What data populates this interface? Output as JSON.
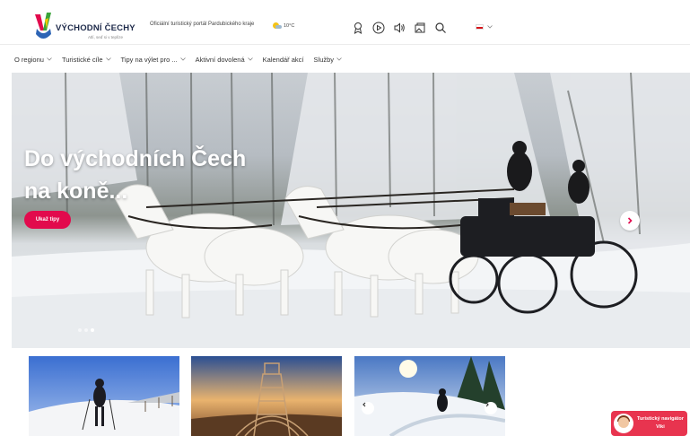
{
  "header": {
    "logo_text": "VÝCHODNÍ ČECHY",
    "logo_tagline": "Atlí, seď si v teplíze",
    "portal_text": "Oficiální turistický portál Pardubického kraje",
    "weather_temp": "10°C",
    "icons": [
      "award-icon",
      "play-icon",
      "speaker-icon",
      "gallery-icon",
      "search-icon"
    ],
    "language": "cz"
  },
  "nav": {
    "items": [
      {
        "label": "O regionu",
        "has_dropdown": true
      },
      {
        "label": "Turistické cíle",
        "has_dropdown": true
      },
      {
        "label": "Tipy na výlet pro ...",
        "has_dropdown": true
      },
      {
        "label": "Aktivní dovolená",
        "has_dropdown": true
      },
      {
        "label": "Kalendář akcí",
        "has_dropdown": false
      },
      {
        "label": "Služby",
        "has_dropdown": true
      }
    ]
  },
  "hero": {
    "title_line1": "Do východních Čech",
    "title_line2": "na koně...",
    "button_label": "Ukaž tipy",
    "slide_count": 3,
    "active_slide": 2
  },
  "cards": [
    {
      "image": "winter-hiker"
    },
    {
      "image": "sky-walk-tower"
    },
    {
      "image": "ski-slope"
    }
  ],
  "navigator": {
    "line1": "Turistický navigátor",
    "line2": "Viki"
  },
  "colors": {
    "accent": "#e20a4d",
    "navigator": "#e8344f",
    "logo_navy": "#1e2a4a"
  }
}
